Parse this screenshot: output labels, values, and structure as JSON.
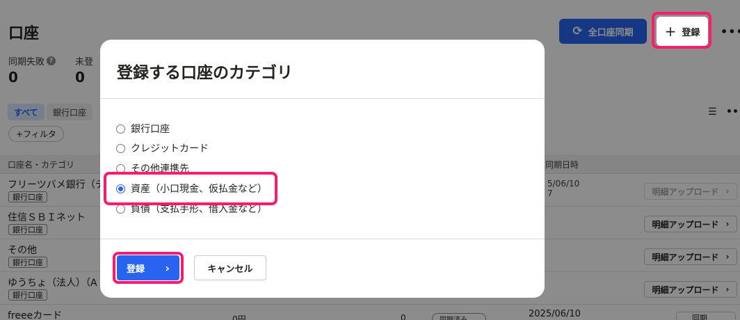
{
  "page": {
    "title": "口座",
    "sync_all_label": "全口座同期",
    "register_label": "登録",
    "stats": [
      {
        "label": "同期失敗",
        "value": "0"
      },
      {
        "label": "未登",
        "value": "0"
      }
    ],
    "filter_chips": [
      "すべて",
      "銀行口座"
    ],
    "add_filter_label": "+フィルタ",
    "table_headers": {
      "name": "口座名・カテゴリ",
      "sync_date": "同期日時"
    },
    "rows": [
      {
        "name": "フリーツバメ銀行（テ",
        "category": "銀行口座",
        "date": "5/06/10",
        "date2": "7",
        "action": "明細アップロード",
        "disabled": true
      },
      {
        "name": "住信ＳＢＩネット",
        "category": "銀行口座",
        "action": "明細アップロード",
        "disabled": false
      },
      {
        "name": "その他",
        "category": "銀行口座",
        "action": "明細アップロード",
        "disabled": false
      },
      {
        "name": "ゆうちょ（法人）（A",
        "category": "銀行口座",
        "action": "明細アップロード",
        "disabled": false
      }
    ],
    "last_row": {
      "name": "freeeカード",
      "amount": "0円",
      "count": "0",
      "status": "同期済み",
      "date": "2025/06/10",
      "action": "同期"
    }
  },
  "modal": {
    "title": "登録する口座のカテゴリ",
    "options": [
      {
        "label": "銀行口座",
        "checked": false
      },
      {
        "label": "クレジットカード",
        "checked": false
      },
      {
        "label": "その他連携先",
        "checked": false
      },
      {
        "label": "資産（小口現金、仮払金など）",
        "checked": true
      },
      {
        "label": "負債（支払手形、借入金など）",
        "checked": false
      }
    ],
    "submit_label": "登録",
    "cancel_label": "キャンセル"
  },
  "colors": {
    "accent": "#2864f0",
    "highlight": "#ff1a6c"
  }
}
